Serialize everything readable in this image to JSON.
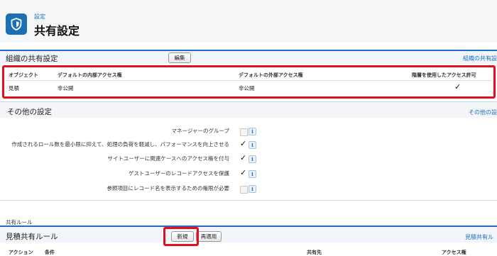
{
  "header": {
    "breadcrumb": "設定",
    "title": "共有設定",
    "icon": "shield-icon",
    "icon_color": "#1c6fb5"
  },
  "org_section": {
    "title": "組織の共有設定",
    "edit_button": "編集",
    "help_link": "組織の共有設",
    "columns": [
      "オブジェクト",
      "デフォルトの内部アクセス権",
      "デフォルトの外部アクセス権",
      "階層を使用したアクセス許可"
    ],
    "rows": [
      {
        "object": "見積",
        "internal": "非公開",
        "external": "非公開",
        "hierarchy": "✓"
      }
    ]
  },
  "other_section": {
    "title": "その他の設定",
    "help_link": "その他の設",
    "settings": [
      {
        "label": "マネージャーのグループ",
        "checked": false
      },
      {
        "label": "作成されるロール数を最小限に抑えて、処理の負荷を軽減し、パフォーマンスを向上させる",
        "checked": true
      },
      {
        "label": "サイトユーザーに関連ケースへのアクセス権を付与",
        "checked": true
      },
      {
        "label": "ゲストユーザーのレコードアクセスを保護",
        "checked": true
      },
      {
        "label": "参照項目にレコード名を表示するための権限が必要",
        "checked": false
      }
    ],
    "info_glyph": "i"
  },
  "sharing_rules": {
    "caption": "共有ルール",
    "section_title": "見積共有ルール",
    "new_button": "新規",
    "reapply_button": "再適用",
    "help_link": "見積共有ル",
    "columns": [
      "アクション",
      "条件",
      "共有先",
      "アクセス権"
    ]
  },
  "colors": {
    "accent": "#1f6dbf",
    "highlight": "#e0101e"
  }
}
